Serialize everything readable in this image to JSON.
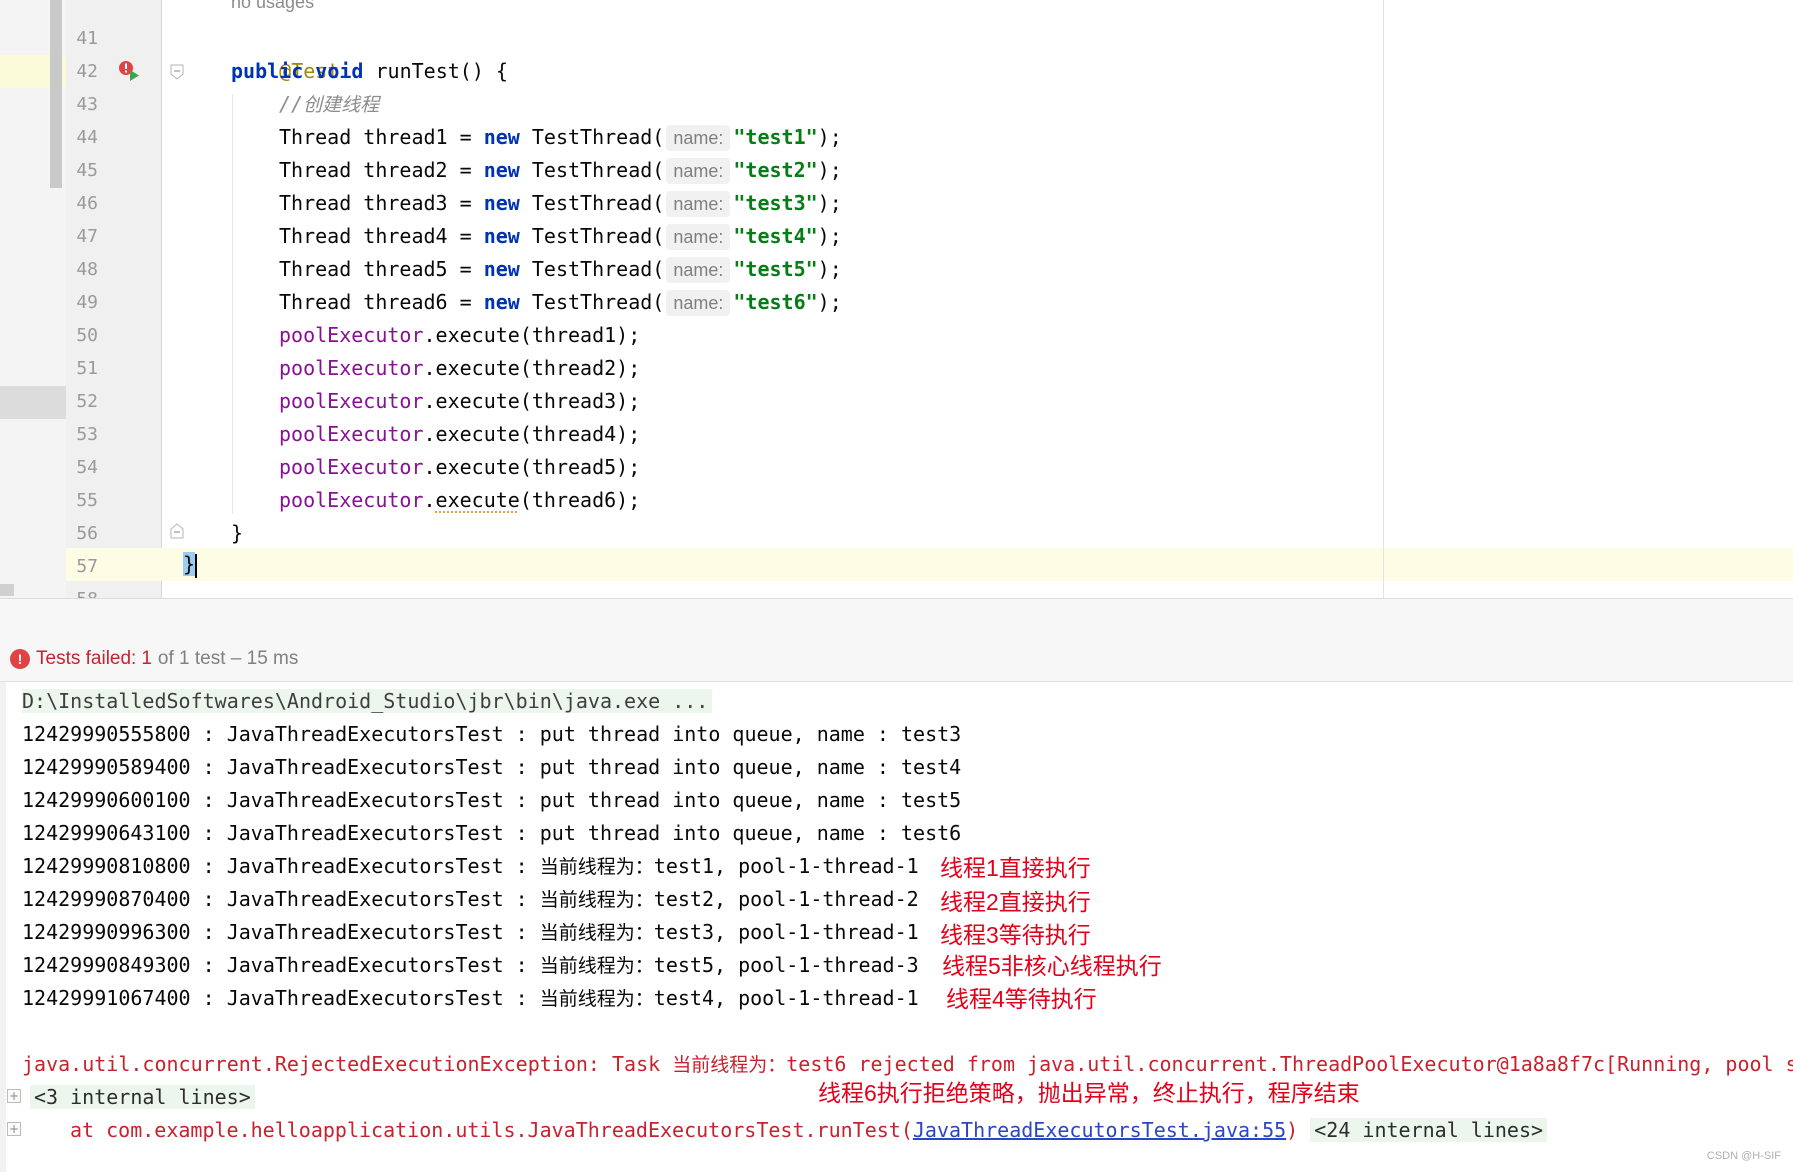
{
  "editor": {
    "no_usages": "no usages",
    "lines": [
      {
        "num": "41"
      },
      {
        "num": "42"
      },
      {
        "num": "43"
      },
      {
        "num": "44"
      },
      {
        "num": "45"
      },
      {
        "num": "46"
      },
      {
        "num": "47"
      },
      {
        "num": "48"
      },
      {
        "num": "49"
      },
      {
        "num": "50"
      },
      {
        "num": "51"
      },
      {
        "num": "52"
      },
      {
        "num": "53"
      },
      {
        "num": "54"
      },
      {
        "num": "55"
      },
      {
        "num": "56"
      },
      {
        "num": "57"
      },
      {
        "num": "58"
      }
    ],
    "annotation": "@Test",
    "kw_public": "public",
    "kw_void": "void",
    "method_sig": " runTest() {",
    "comment_slashes": "//",
    "comment_text": "创建线程",
    "thread_decls": [
      {
        "decl": "Thread thread1 = ",
        "kw": "new",
        "ctor": " TestThread(",
        "hint": "name:",
        "arg": "\"test1\"",
        "end": ");"
      },
      {
        "decl": "Thread thread2 = ",
        "kw": "new",
        "ctor": " TestThread(",
        "hint": "name:",
        "arg": "\"test2\"",
        "end": ");"
      },
      {
        "decl": "Thread thread3 = ",
        "kw": "new",
        "ctor": " TestThread(",
        "hint": "name:",
        "arg": "\"test3\"",
        "end": ");"
      },
      {
        "decl": "Thread thread4 = ",
        "kw": "new",
        "ctor": " TestThread(",
        "hint": "name:",
        "arg": "\"test4\"",
        "end": ");"
      },
      {
        "decl": "Thread thread5 = ",
        "kw": "new",
        "ctor": " TestThread(",
        "hint": "name:",
        "arg": "\"test5\"",
        "end": ");"
      },
      {
        "decl": "Thread thread6 = ",
        "kw": "new",
        "ctor": " TestThread(",
        "hint": "name:",
        "arg": "\"test6\"",
        "end": ");"
      }
    ],
    "executes": [
      {
        "field": "poolExecutor",
        "dot": ".",
        "method": "execute",
        "args": "(thread1);"
      },
      {
        "field": "poolExecutor",
        "dot": ".",
        "method": "execute",
        "args": "(thread2);"
      },
      {
        "field": "poolExecutor",
        "dot": ".",
        "method": "execute",
        "args": "(thread3);"
      },
      {
        "field": "poolExecutor",
        "dot": ".",
        "method": "execute",
        "args": "(thread4);"
      },
      {
        "field": "poolExecutor",
        "dot": ".",
        "method": "execute",
        "args": "(thread5);"
      },
      {
        "field": "poolExecutor",
        "dot": ".",
        "method": "execute",
        "args": "(thread6);"
      }
    ],
    "method_close": "}",
    "class_close": "}"
  },
  "status": {
    "label": "Tests failed:",
    "count": "1",
    "rest": "of 1 test – 15 ms",
    "icon_glyph": "!"
  },
  "console": {
    "cmd": "D:\\InstalledSoftwares\\Android_Studio\\jbr\\bin\\java.exe ...",
    "queue_lines": [
      "12429990555800 : JavaThreadExecutorsTest : put thread into queue, name : test3",
      "12429990589400 : JavaThreadExecutorsTest : put thread into queue, name : test4",
      "12429990600100 : JavaThreadExecutorsTest : put thread into queue, name : test5",
      "12429990643100 : JavaThreadExecutorsTest : put thread into queue, name : test6"
    ],
    "exec_lines": [
      {
        "prefix": "12429990810800 : JavaThreadExecutorsTest : ",
        "cn": "当前线程为：",
        "suffix": "test1, pool-1-thread-1",
        "note": "线程1直接执行"
      },
      {
        "prefix": "12429990870400 : JavaThreadExecutorsTest : ",
        "cn": "当前线程为：",
        "suffix": "test2, pool-1-thread-2",
        "note": "线程2直接执行"
      },
      {
        "prefix": "12429990996300 : JavaThreadExecutorsTest : ",
        "cn": "当前线程为：",
        "suffix": "test3, pool-1-thread-1",
        "note": "线程3等待执行"
      },
      {
        "prefix": "12429990849300 : JavaThreadExecutorsTest : ",
        "cn": "当前线程为：",
        "suffix": "test5, pool-1-thread-3",
        "note": "线程5非核心线程执行"
      },
      {
        "prefix": "12429991067400 : JavaThreadExecutorsTest : ",
        "cn": "当前线程为：",
        "suffix": "test4, pool-1-thread-1",
        "note": "线程4等待执行"
      }
    ],
    "exception_prefix": "java.util.concurrent.RejectedExecutionException: Task ",
    "exception_cn": "当前线程为：",
    "exception_suffix": "test6 rejected from java.util.concurrent.ThreadPoolExecutor@1a8a8f7c[Running, pool s",
    "reject_note": "线程6执行拒绝策略，抛出异常，终止执行，程序结束",
    "internal_3": "<3 internal lines>",
    "at_prefix": "at com.example.helloapplication.utils.JavaThreadExecutorsTest.runTest(",
    "at_link": "JavaThreadExecutorsTest.java:55",
    "at_close": ")",
    "internal_24": "<24 internal lines>",
    "expand_glyph": "+",
    "watermark": "CSDN @H-SIF"
  },
  "colors": {
    "keyword": "#0033b3",
    "string": "#067d17",
    "field": "#871094",
    "annotation": "#9e880d",
    "error": "#c7222d",
    "annotation_red": "#e2001a"
  }
}
